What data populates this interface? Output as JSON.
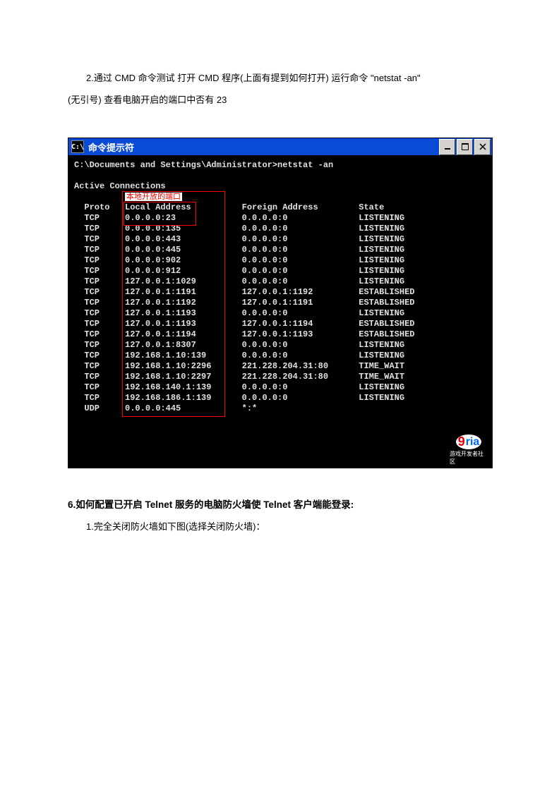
{
  "document": {
    "intro_line1": "2.通过 CMD 命令测试 打开 CMD 程序(上面有提到如何打开)  运行命令  \"netstat -an\"",
    "intro_line2": "(无引号)  查看电脑开启的端口中否有 23",
    "section6_heading": "6.如何配置已开启 Telnet 服务的电脑防火墙使 Telnet 客户端能登录:",
    "section6_step1": "1.完全关闭防火墙如下图(选择关闭防火墙)："
  },
  "window": {
    "title": "命令提示符",
    "icon_text": "C:\\"
  },
  "terminal": {
    "prompt": "C:\\Documents and Settings\\Administrator>netstat -an",
    "header_line": "Active Connections",
    "annotation": "本地开放的端口",
    "columns": {
      "proto": "Proto",
      "local": "Local Address",
      "foreign": "Foreign Address",
      "state": "State"
    },
    "rows": [
      {
        "proto": "TCP",
        "local": "0.0.0.0:23",
        "foreign": "0.0.0.0:0",
        "state": "LISTENING"
      },
      {
        "proto": "TCP",
        "local": "0.0.0.0:135",
        "foreign": "0.0.0.0:0",
        "state": "LISTENING"
      },
      {
        "proto": "TCP",
        "local": "0.0.0.0:443",
        "foreign": "0.0.0.0:0",
        "state": "LISTENING"
      },
      {
        "proto": "TCP",
        "local": "0.0.0.0:445",
        "foreign": "0.0.0.0:0",
        "state": "LISTENING"
      },
      {
        "proto": "TCP",
        "local": "0.0.0.0:902",
        "foreign": "0.0.0.0:0",
        "state": "LISTENING"
      },
      {
        "proto": "TCP",
        "local": "0.0.0.0:912",
        "foreign": "0.0.0.0:0",
        "state": "LISTENING"
      },
      {
        "proto": "TCP",
        "local": "127.0.0.1:1029",
        "foreign": "0.0.0.0:0",
        "state": "LISTENING"
      },
      {
        "proto": "TCP",
        "local": "127.0.0.1:1191",
        "foreign": "127.0.0.1:1192",
        "state": "ESTABLISHED"
      },
      {
        "proto": "TCP",
        "local": "127.0.0.1:1192",
        "foreign": "127.0.0.1:1191",
        "state": "ESTABLISHED"
      },
      {
        "proto": "TCP",
        "local": "127.0.0.1:1193",
        "foreign": "0.0.0.0:0",
        "state": "LISTENING"
      },
      {
        "proto": "TCP",
        "local": "127.0.0.1:1193",
        "foreign": "127.0.0.1:1194",
        "state": "ESTABLISHED"
      },
      {
        "proto": "TCP",
        "local": "127.0.0.1:1194",
        "foreign": "127.0.0.1:1193",
        "state": "ESTABLISHED"
      },
      {
        "proto": "TCP",
        "local": "127.0.0.1:8307",
        "foreign": "0.0.0.0:0",
        "state": "LISTENING"
      },
      {
        "proto": "TCP",
        "local": "192.168.1.10:139",
        "foreign": "0.0.0.0:0",
        "state": "LISTENING"
      },
      {
        "proto": "TCP",
        "local": "192.168.1.10:2296",
        "foreign": "221.228.204.31:80",
        "state": "TIME_WAIT"
      },
      {
        "proto": "TCP",
        "local": "192.168.1.10:2297",
        "foreign": "221.228.204.31:80",
        "state": "TIME_WAIT"
      },
      {
        "proto": "TCP",
        "local": "192.168.140.1:139",
        "foreign": "0.0.0.0:0",
        "state": "LISTENING"
      },
      {
        "proto": "TCP",
        "local": "192.168.186.1:139",
        "foreign": "0.0.0.0:0",
        "state": "LISTENING"
      },
      {
        "proto": "UDP",
        "local": "0.0.0.0:445",
        "foreign": "*:*",
        "state": ""
      }
    ]
  },
  "watermark": {
    "text": "9ria",
    "sub": "游戏开发者社区"
  }
}
